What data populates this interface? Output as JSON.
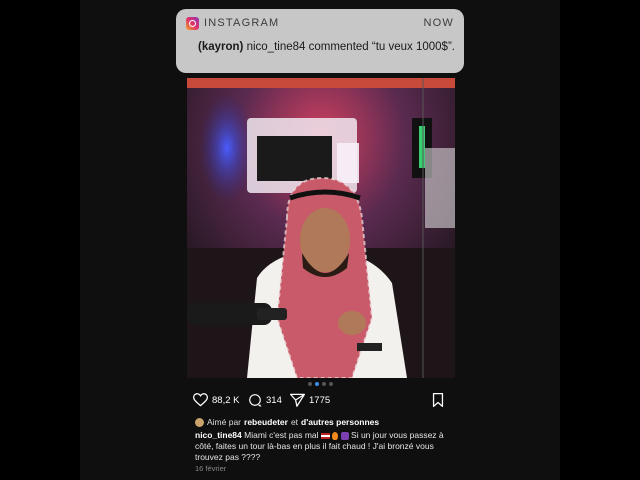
{
  "notification": {
    "app": "INSTAGRAM",
    "time": "NOW",
    "sender": "(kayron)",
    "message": "nico_tine84 commented “tu veux 1000$”."
  },
  "post": {
    "carousel_pages": 4,
    "carousel_active": 1,
    "likes": "88,2 K",
    "comments": "314",
    "shares": "1775",
    "liked_by_prefix": "Aimé par",
    "liked_by_user": "rebeudeter",
    "liked_by_suffix": "et",
    "liked_by_others": "d'autres personnes",
    "caption_user": "nico_tine84",
    "caption_text_1": "Miami c'est pas mal",
    "caption_text_2": "Si un jour vous passez à côté, faites un tour là-bas en plus il fait chaud ! J'ai bronzé vous trouvez pas ????",
    "date": "16 février"
  },
  "icons": {
    "app": "instagram-icon",
    "like": "heart-icon",
    "comment": "comment-icon",
    "share": "send-icon",
    "save": "bookmark-icon"
  },
  "colors": {
    "notification_bg": "#c7c7c7",
    "carousel_active": "#3b8fe8",
    "background": "#000000"
  }
}
